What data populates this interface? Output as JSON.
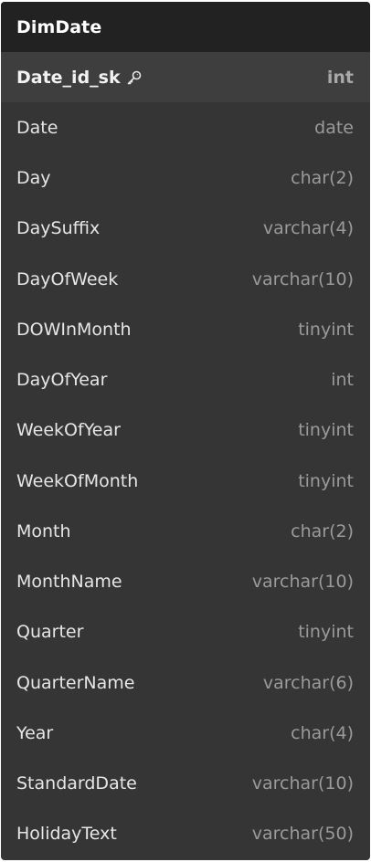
{
  "table": {
    "name": "DimDate",
    "columns": [
      {
        "name": "Date_id_sk",
        "type": "int",
        "primary_key": true,
        "icon": "key-icon"
      },
      {
        "name": "Date",
        "type": "date"
      },
      {
        "name": "Day",
        "type": "char(2)"
      },
      {
        "name": "DaySuffix",
        "type": "varchar(4)"
      },
      {
        "name": "DayOfWeek",
        "type": "varchar(10)"
      },
      {
        "name": "DOWInMonth",
        "type": "tinyint"
      },
      {
        "name": "DayOfYear",
        "type": "int"
      },
      {
        "name": "WeekOfYear",
        "type": "tinyint"
      },
      {
        "name": "WeekOfMonth",
        "type": "tinyint"
      },
      {
        "name": "Month",
        "type": "char(2)"
      },
      {
        "name": "MonthName",
        "type": "varchar(10)"
      },
      {
        "name": "Quarter",
        "type": "tinyint"
      },
      {
        "name": "QuarterName",
        "type": "varchar(6)"
      },
      {
        "name": "Year",
        "type": "char(4)"
      },
      {
        "name": "StandardDate",
        "type": "varchar(10)"
      },
      {
        "name": "HolidayText",
        "type": "varchar(50)"
      }
    ]
  },
  "colors": {
    "header_bg": "#222222",
    "body_bg": "#353535",
    "pk_row_bg": "#3e3e3e",
    "name_text": "#e6e6e6",
    "type_text": "#9a9a9a"
  }
}
